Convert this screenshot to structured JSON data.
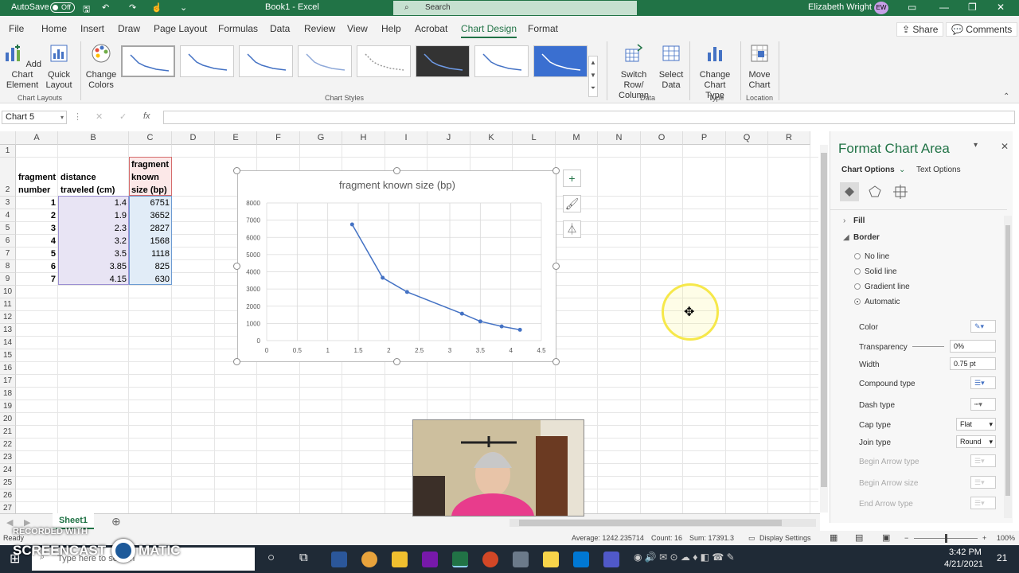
{
  "titlebar": {
    "autosave_label": "AutoSave",
    "autosave_state": "Off",
    "doc_title": "Book1 - Excel",
    "search_placeholder": "Search",
    "user_name": "Elizabeth Wright",
    "user_initials": "EW"
  },
  "menu": {
    "tabs": [
      "File",
      "Home",
      "Insert",
      "Draw",
      "Page Layout",
      "Formulas",
      "Data",
      "Review",
      "View",
      "Help",
      "Acrobat",
      "Chart Design",
      "Format"
    ],
    "active_tab": "Chart Design",
    "share_label": "Share",
    "comments_label": "Comments"
  },
  "ribbon": {
    "add_chart_element": "Add Chart Element",
    "quick_layout": "Quick Layout",
    "change_colors": "Change Colors",
    "group_chart_layouts": "Chart Layouts",
    "group_chart_styles": "Chart Styles",
    "switch_row_column": "Switch Row/ Column",
    "select_data": "Select Data",
    "group_data": "Data",
    "change_chart_type": "Change Chart Type",
    "group_type": "Type",
    "move_chart": "Move Chart",
    "group_location": "Location"
  },
  "formula_bar": {
    "name_box": "Chart 5",
    "fx": "fx"
  },
  "columns": [
    "A",
    "B",
    "C",
    "D",
    "E",
    "F",
    "G",
    "H",
    "I",
    "J",
    "K",
    "L",
    "M",
    "N",
    "O",
    "P",
    "Q",
    "R"
  ],
  "rows": [
    "1",
    "2",
    "3",
    "4",
    "5",
    "6",
    "7",
    "8",
    "9",
    "10",
    "11",
    "12",
    "13",
    "14",
    "15",
    "16",
    "17",
    "18",
    "19",
    "20",
    "21",
    "22",
    "23",
    "24",
    "25",
    "26",
    "27"
  ],
  "table": {
    "header_a": [
      "fragment",
      "number"
    ],
    "header_b": [
      "distance",
      "traveled (cm)"
    ],
    "header_c": [
      "fragment",
      "known",
      "size (bp)"
    ],
    "rows": [
      {
        "n": "1",
        "d": "1.4",
        "s": "6751"
      },
      {
        "n": "2",
        "d": "1.9",
        "s": "3652"
      },
      {
        "n": "3",
        "d": "2.3",
        "s": "2827"
      },
      {
        "n": "4",
        "d": "3.2",
        "s": "1568"
      },
      {
        "n": "5",
        "d": "3.5",
        "s": "1118"
      },
      {
        "n": "6",
        "d": "3.85",
        "s": "825"
      },
      {
        "n": "7",
        "d": "4.15",
        "s": "630"
      }
    ]
  },
  "chart_data": {
    "type": "line",
    "title": "fragment known size (bp)",
    "x": [
      1.4,
      1.9,
      2.3,
      3.2,
      3.5,
      3.85,
      4.15
    ],
    "y": [
      6751,
      3652,
      2827,
      1568,
      1118,
      825,
      630
    ],
    "xlim": [
      0,
      4.5
    ],
    "ylim": [
      0,
      8000
    ],
    "xticks": [
      "0",
      "0.5",
      "1",
      "1.5",
      "2",
      "2.5",
      "3",
      "3.5",
      "4",
      "4.5"
    ],
    "yticks": [
      "0",
      "1000",
      "2000",
      "3000",
      "4000",
      "5000",
      "6000",
      "7000",
      "8000"
    ],
    "grid": true,
    "color": "#4472c4"
  },
  "panel": {
    "title": "Format Chart Area",
    "tab_chart_options": "Chart Options",
    "tab_text_options": "Text Options",
    "fill": "Fill",
    "border": "Border",
    "no_line": "No line",
    "solid_line": "Solid line",
    "gradient_line": "Gradient line",
    "automatic": "Automatic",
    "color": "Color",
    "transparency": "Transparency",
    "transparency_value": "0%",
    "width": "Width",
    "width_value": "0.75 pt",
    "compound_type": "Compound type",
    "dash_type": "Dash type",
    "cap_type": "Cap type",
    "cap_value": "Flat",
    "join_type": "Join type",
    "join_value": "Round",
    "begin_arrow_type": "Begin Arrow type",
    "begin_arrow_size": "Begin Arrow size",
    "end_arrow_type": "End Arrow type"
  },
  "sheet": {
    "tab": "Sheet1"
  },
  "status": {
    "ready": "Ready",
    "average": "Average: 1242.235714",
    "count": "Count: 16",
    "sum": "Sum: 17391.3",
    "display_settings": "Display Settings",
    "zoom": "100%"
  },
  "taskbar": {
    "search": "Type here to search",
    "time": "3:42 PM",
    "date": "4/21/2021",
    "notif_count": "21"
  },
  "watermark": {
    "line1": "RECORDED WITH",
    "line2": "SCREENCAST",
    "line3": "MATIC"
  }
}
